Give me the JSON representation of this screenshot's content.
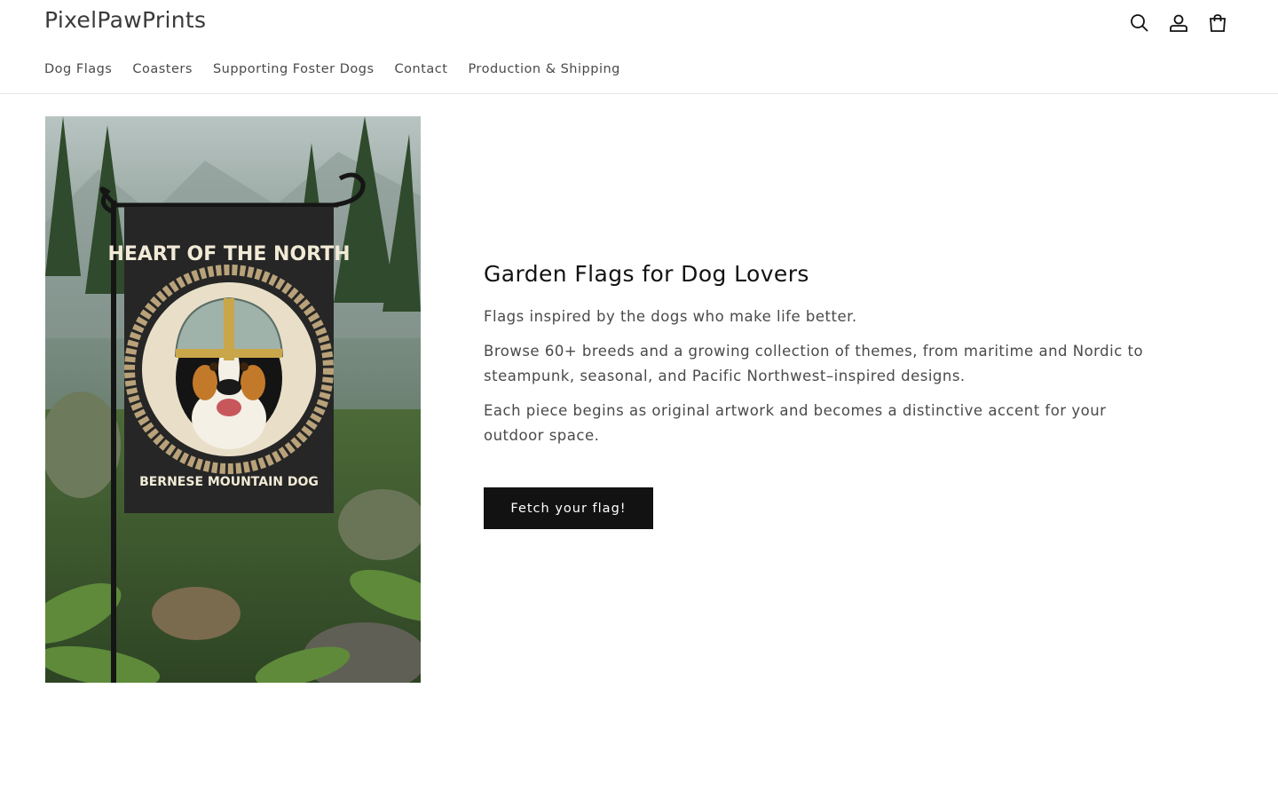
{
  "header": {
    "brand": "PixelPawPrints",
    "icons": [
      "search-icon",
      "account-icon",
      "cart-icon"
    ]
  },
  "nav": {
    "items": [
      {
        "label": "Dog Flags"
      },
      {
        "label": "Coasters"
      },
      {
        "label": "Supporting Foster Dogs"
      },
      {
        "label": "Contact"
      },
      {
        "label": "Production & Shipping"
      }
    ]
  },
  "hero": {
    "image": {
      "flag_title": "HEART OF THE NORTH",
      "flag_subtitle": "BERNESE MOUNTAIN DOG"
    },
    "title": "Garden Flags for Dog Lovers",
    "paragraphs": [
      "Flags inspired by the dogs who make life better.",
      "Browse 60+ breeds and a growing collection of themes, from maritime and Nordic to steampunk, seasonal, and Pacific Northwest–inspired designs.",
      "Each piece begins as original artwork and becomes a distinctive accent for your outdoor space."
    ],
    "cta_label": "Fetch your flag!"
  },
  "colors": {
    "button_bg": "#121212",
    "text_primary": "#121212",
    "text_secondary": "#4a4a4a",
    "border": "#e6e6e6"
  }
}
